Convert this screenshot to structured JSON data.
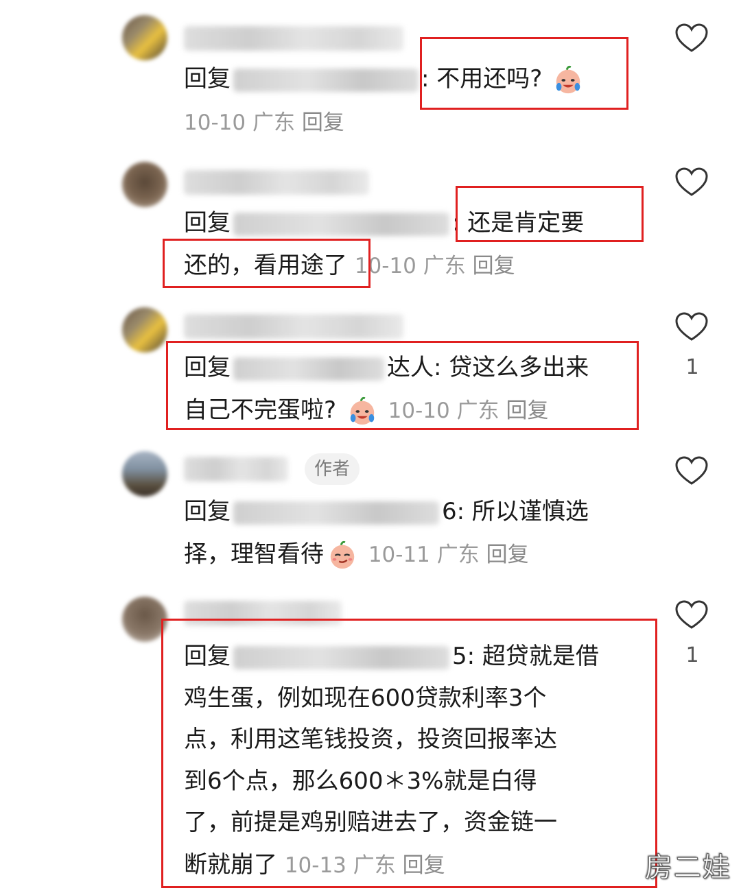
{
  "comments": [
    {
      "reply_prefix": "回复",
      "text_suffix": ": 不用还吗?",
      "date": "10-10",
      "location": "广东",
      "reply_action": "回复",
      "likes": ""
    },
    {
      "reply_prefix": "回复",
      "line1_suffix": ": 还是肯定要",
      "line2": "还的，看用途了",
      "date": "10-10",
      "location": "广东",
      "reply_action": "回复",
      "likes": ""
    },
    {
      "reply_prefix": "回复",
      "line1_tail": "达人: 贷这么多出来",
      "line2": "自己不完蛋啦?",
      "date": "10-10",
      "location": "广东",
      "reply_action": "回复",
      "likes": "1"
    },
    {
      "badge": "作者",
      "reply_prefix": "回复",
      "line1_suffix": "6: 所以谨慎选",
      "line2": "择，理智看待",
      "date": "10-11",
      "location": "广东",
      "reply_action": "回复",
      "likes": ""
    },
    {
      "reply_prefix": "回复",
      "line1_suffix": "5: 超贷就是借",
      "lines": [
        "鸡生蛋，例如现在600贷款利率3个",
        "点，利用这笔钱投资，投资回报率达",
        "到6个点，那么600＊3%就是白得",
        "了，前提是鸡别赔进去了，资金链一"
      ],
      "last_line": "断就崩了",
      "date": "10-13",
      "location": "广东",
      "reply_action": "回复",
      "likes": "1"
    }
  ],
  "watermark": "房二娃",
  "colors": {
    "highlight_box": "#e02020",
    "meta_gray": "#9a9a9a"
  },
  "icons": {
    "like": "heart-outline-icon",
    "emoji": "crying-laughing-face-icon",
    "emoji_smirk": "smirk-face-icon"
  }
}
